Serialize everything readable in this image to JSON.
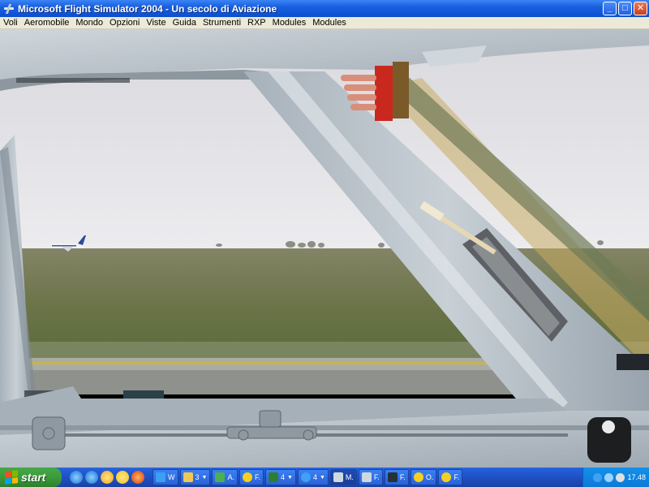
{
  "window": {
    "title": "Microsoft Flight Simulator 2004 - Un secolo di Aviazione",
    "buttons": {
      "minimize": "_",
      "maximize": "□",
      "close": "✕"
    }
  },
  "menu": [
    "Voli",
    "Aeromobile",
    "Mondo",
    "Opzioni",
    "Viste",
    "Guida",
    "Strumenti",
    "RXP",
    "Modules",
    "Modules"
  ],
  "taskbar": {
    "start_label": "start",
    "quick_launch": [
      "ie-icon",
      "ie-icon",
      "media-icon",
      "smiley-icon",
      "firefox-icon"
    ],
    "tasks": [
      {
        "label": "W",
        "icon": "messenger-icon",
        "color": "#3aa0f0",
        "active": false,
        "arrow": false
      },
      {
        "label": "3",
        "icon": "folder-icon",
        "color": "#f0c850",
        "active": false,
        "arrow": true
      },
      {
        "label": "A.",
        "icon": "app-icon",
        "color": "#4caf50",
        "active": false,
        "arrow": false
      },
      {
        "label": "F.",
        "icon": "smiley-icon",
        "color": "#f5d020",
        "active": false,
        "arrow": false
      },
      {
        "label": "4",
        "icon": "excel-icon",
        "color": "#2e7d32",
        "active": false,
        "arrow": true
      },
      {
        "label": "4",
        "icon": "ie-icon",
        "color": "#3fa0f5",
        "active": false,
        "arrow": true
      },
      {
        "label": "M.",
        "icon": "plane-icon",
        "color": "#cfd8dc",
        "active": true,
        "arrow": false
      },
      {
        "label": "F.",
        "icon": "plane-icon",
        "color": "#cfd8dc",
        "active": false,
        "arrow": false
      },
      {
        "label": "F.",
        "icon": "window-icon",
        "color": "#263238",
        "active": false,
        "arrow": false
      },
      {
        "label": "O.",
        "icon": "smiley-icon",
        "color": "#f5d020",
        "active": false,
        "arrow": false
      },
      {
        "label": "F.",
        "icon": "smiley-icon",
        "color": "#f5d020",
        "active": false,
        "arrow": false
      }
    ],
    "clock": "17.48"
  },
  "colors": {
    "sky": "#e6e6ea",
    "grass": "#6f7650",
    "frame": "#b9c3cc"
  }
}
